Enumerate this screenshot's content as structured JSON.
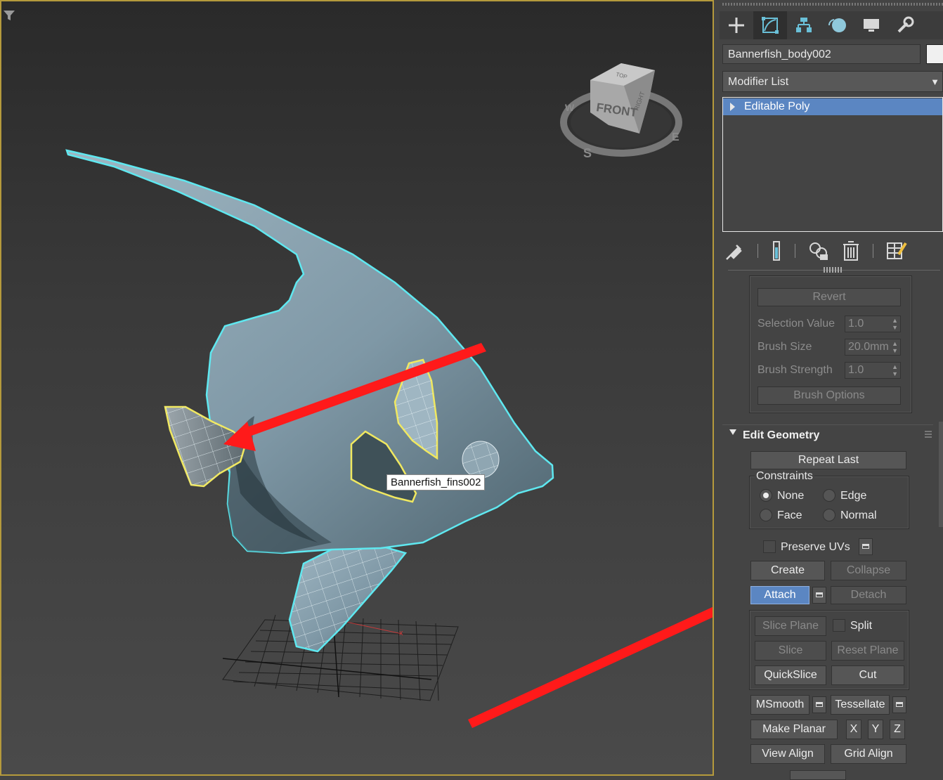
{
  "viewport": {
    "tooltip": "Bannerfish_fins002",
    "viewcube": {
      "front": "FRONT",
      "right": "RIGHT",
      "top": "TOP",
      "south": "S",
      "west": "W",
      "east": "E"
    },
    "accent_colors": {
      "selection_outline": "#5fe8f0",
      "fin_outline": "#f0e860",
      "arrow": "#ff1a1a",
      "border": "#b59a3c"
    }
  },
  "command_panel": {
    "tabs": [
      "create-icon",
      "modify-icon",
      "hierarchy-icon",
      "motion-icon",
      "display-icon",
      "utilities-icon"
    ],
    "object_name": "Bannerfish_body002",
    "modifier_list": "Modifier List",
    "stack_items": [
      "Editable Poly"
    ],
    "stack_tools": [
      "pin-stack-icon",
      "show-end-result-icon",
      "make-unique-icon",
      "remove-modifier-icon",
      "configure-modifier-sets-icon"
    ]
  },
  "soft_selection": {
    "revert": "Revert",
    "selection_value_label": "Selection Value",
    "selection_value": "1.0",
    "brush_size_label": "Brush Size",
    "brush_size": "20.0mm",
    "brush_strength_label": "Brush Strength",
    "brush_strength": "1.0",
    "brush_options": "Brush Options"
  },
  "edit_geometry": {
    "title": "Edit Geometry",
    "repeat_last": "Repeat Last",
    "constraints_label": "Constraints",
    "constraints": {
      "none": "None",
      "edge": "Edge",
      "face": "Face",
      "normal": "Normal",
      "selected": "None"
    },
    "preserve_uvs": "Preserve UVs",
    "create": "Create",
    "collapse": "Collapse",
    "attach": "Attach",
    "detach": "Detach",
    "slice_plane": "Slice Plane",
    "split": "Split",
    "slice": "Slice",
    "reset_plane": "Reset Plane",
    "quickslice": "QuickSlice",
    "cut": "Cut",
    "msmooth": "MSmooth",
    "tessellate": "Tessellate",
    "make_planar": "Make Planar",
    "x": "X",
    "y": "Y",
    "z": "Z",
    "view_align": "View Align",
    "grid_align": "Grid Align"
  }
}
